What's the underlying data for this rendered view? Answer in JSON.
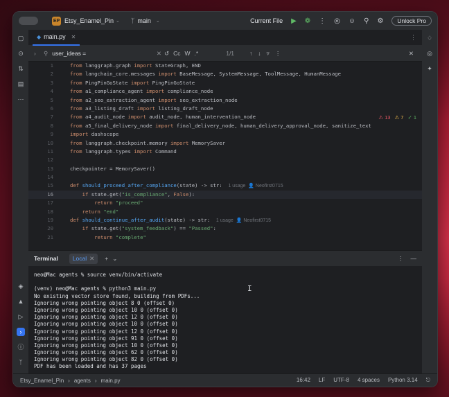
{
  "titlebar": {
    "project_badge": "EP",
    "project_name": "Etsy_Enamel_Pin",
    "branch": "main",
    "run_config": "Current File",
    "unlock_label": "Unlock Pro"
  },
  "editor": {
    "tab_label": "main.py",
    "find": {
      "query": "user_ideas =",
      "opt_case": "Cc",
      "opt_word": "W",
      "opt_regex": ".*",
      "count": "1/1"
    },
    "problems": {
      "errors": "13",
      "warnings": "7",
      "ok": "1"
    },
    "lines": [
      {
        "n": "1",
        "html": "<span class='kw'>from</span> langgraph.graph <span class='kw'>import</span> StateGraph, END"
      },
      {
        "n": "2",
        "html": "<span class='kw'>from</span> langchain_core.messages <span class='kw'>import</span> BaseMessage, SystemMessage, ToolMessage, HumanMessage"
      },
      {
        "n": "3",
        "html": "<span class='kw'>from</span> PingPinGoState <span class='kw'>import</span> PingPinGoState"
      },
      {
        "n": "4",
        "html": "<span class='kw'>from</span> a1_compliance_agent <span class='kw'>import</span> compliance_node"
      },
      {
        "n": "5",
        "html": "<span class='kw'>from</span> a2_seo_extraction_agent <span class='kw'>import</span> seo_extraction_node"
      },
      {
        "n": "6",
        "html": "<span class='kw'>from</span> a3_listing_draft <span class='kw'>import</span> listing_draft_node"
      },
      {
        "n": "7",
        "html": "<span class='kw'>from</span> a4_audit_node <span class='kw'>import</span> audit_node, human_intervention_node"
      },
      {
        "n": "8",
        "html": "<span class='kw'>from</span> a5_final_delivery_node <span class='kw'>import</span> final_delivery_node, human_delivery_approval_node, sanitize_text"
      },
      {
        "n": "9",
        "html": "<span class='kw'>import</span> dashscope"
      },
      {
        "n": "10",
        "html": "<span class='kw'>from</span> langgraph.checkpoint.memory <span class='kw'>import</span> MemorySaver"
      },
      {
        "n": "11",
        "html": "<span class='kw'>from</span> langgraph.types <span class='kw'>import</span> Command"
      },
      {
        "n": "12",
        "html": ""
      },
      {
        "n": "13",
        "html": "checkpointer = MemorySaver()"
      },
      {
        "n": "14",
        "html": ""
      },
      {
        "n": "15",
        "html": "<span class='kw'>def</span> <span class='fn'>should_proceed_after_compliance</span>(state) -&gt; str:  <span class='hint'>1 usage  &#128100; Neofirst0715</span>"
      },
      {
        "n": "16",
        "html": "    <span class='kw'>if</span> state.get(<span class='str'>\"is_compliance\"</span>, <span class='kw'>False</span>):",
        "cur": true
      },
      {
        "n": "17",
        "html": "        <span class='kw'>return</span> <span class='str'>\"proceed\"</span>"
      },
      {
        "n": "18",
        "html": "    <span class='kw'>return</span> <span class='str'>\"end\"</span>"
      },
      {
        "n": "19",
        "html": "<span class='kw'>def</span> <span class='fn'>should_continue_after_audit</span>(state) -&gt; str:  <span class='hint'>1 usage  &#128100; Neofirst0715</span>"
      },
      {
        "n": "20",
        "html": "    <span class='kw'>if</span> state.get(<span class='str'>\"system_feedback\"</span>) == <span class='str'>\"Passed\"</span>:"
      },
      {
        "n": "21",
        "html": "        <span class='kw'>return</span> <span class='str'>\"complete\"</span>"
      }
    ]
  },
  "terminal": {
    "title": "Terminal",
    "tab_label": "Local",
    "lines": [
      "neo@Mac agents % source venv/bin/activate",
      "",
      "(venv) neo@Mac agents % python3 main.py",
      "No existing vector store found, building from PDFs...",
      "Ignoring wrong pointing object 8 0 (offset 0)",
      "Ignoring wrong pointing object 10 0 (offset 0)",
      "Ignoring wrong pointing object 12 0 (offset 0)",
      "Ignoring wrong pointing object 10 0 (offset 0)",
      "Ignoring wrong pointing object 12 0 (offset 0)",
      "Ignoring wrong pointing object 91 0 (offset 0)",
      "Ignoring wrong pointing object 10 0 (offset 0)",
      "Ignoring wrong pointing object 62 0 (offset 0)",
      "Ignoring wrong pointing object 82 0 (offset 0)",
      "PDF has been loaded and has 37 pages"
    ]
  },
  "statusbar": {
    "crumb_project": "Etsy_Enamel_Pin",
    "crumb_folder": "agents",
    "crumb_file": "main.py",
    "position": "16:42",
    "line_sep": "LF",
    "encoding": "UTF-8",
    "indent": "4 spaces",
    "interpreter": "Python 3.14"
  }
}
